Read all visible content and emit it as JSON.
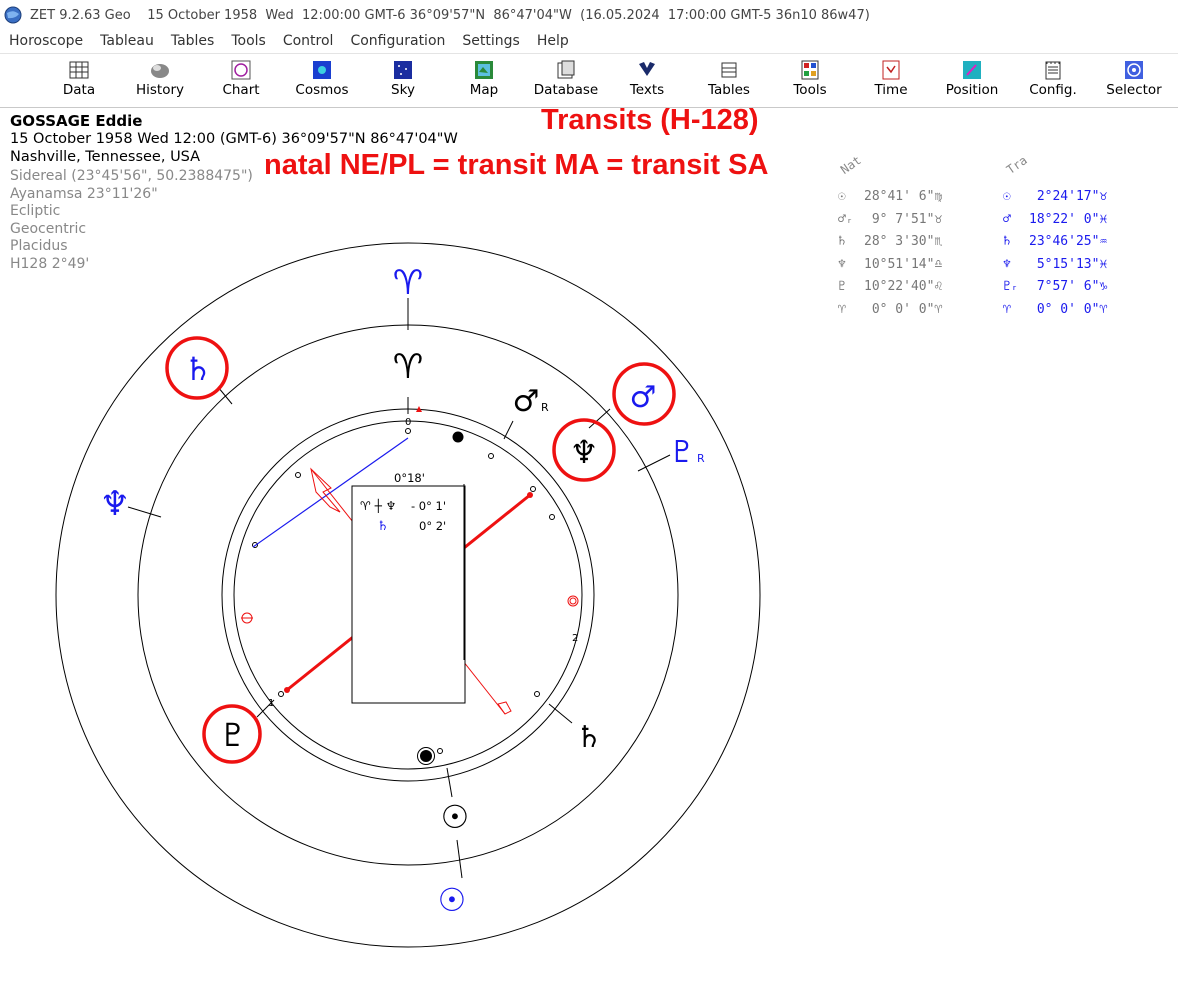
{
  "window": {
    "title": "ZET 9.2.63 Geo    15 October 1958  Wed  12:00:00 GMT-6 36°09'57\"N  86°47'04\"W  (16.05.2024  17:00:00 GMT-5 36n10 86w47)"
  },
  "menu": [
    "Horoscope",
    "Tableau",
    "Tables",
    "Tools",
    "Control",
    "Configuration",
    "Settings",
    "Help"
  ],
  "toolbar": [
    "Data",
    "History",
    "Chart",
    "Cosmos",
    "Sky",
    "Map",
    "Database",
    "Texts",
    "Tables",
    "Tools",
    "Time",
    "Position",
    "Config.",
    "Selector"
  ],
  "person": {
    "name": "GOSSAGE Eddie",
    "datetime": "15 October 1958  Wed  12:00 (GMT-6) 36°09'57\"N  86°47'04\"W",
    "place": "Nashville, Tennessee, USA",
    "settings": [
      "Sidereal (23°45'56\", 50.2388475\")",
      "Ayanamsa 23°11'26\"",
      "Ecliptic",
      "Geocentric",
      "Placidus",
      "H128   2°49'"
    ]
  },
  "annotations": {
    "title": "Transits (H-128)",
    "subtitle": "natal NE/PL = transit MA = transit SA",
    "color": "#ee1111"
  },
  "positions": {
    "natal_header": "Nat",
    "transit_header": "Tra",
    "natal": [
      {
        "glyph": "☉",
        "text": "28°41' 6\"♍"
      },
      {
        "glyph": "♂ᵣ",
        "text": " 9° 7'51\"♉"
      },
      {
        "glyph": "♄",
        "text": "28° 3'30\"♏"
      },
      {
        "glyph": "♆",
        "text": "10°51'14\"♎"
      },
      {
        "glyph": "♇",
        "text": "10°22'40\"♌"
      },
      {
        "glyph": "♈",
        "text": " 0° 0' 0\"♈"
      }
    ],
    "transit": [
      {
        "glyph": "☉",
        "text": " 2°24'17\"♉"
      },
      {
        "glyph": "♂",
        "text": "18°22' 0\"♓"
      },
      {
        "glyph": "♄",
        "text": "23°46'25\"♒"
      },
      {
        "glyph": "♆",
        "text": " 5°15'13\"♓"
      },
      {
        "glyph": "♇ᵣ",
        "text": " 7°57' 6\"♑"
      },
      {
        "glyph": "♈",
        "text": " 0° 0' 0\"♈"
      }
    ]
  },
  "wheel": {
    "box_header": "0°18'",
    "box_rows": [
      {
        "glyphs": "♈ ┼ ♆",
        "value": "- 0° 1'"
      },
      {
        "glyphs": "♄",
        "value": "0° 2'"
      }
    ],
    "labels": {
      "zero": "0",
      "one": "1",
      "two": "2",
      "retro": "R"
    },
    "colors": {
      "natal": "#000000",
      "transit": "#1a1aee",
      "highlight": "#ee1111"
    }
  }
}
